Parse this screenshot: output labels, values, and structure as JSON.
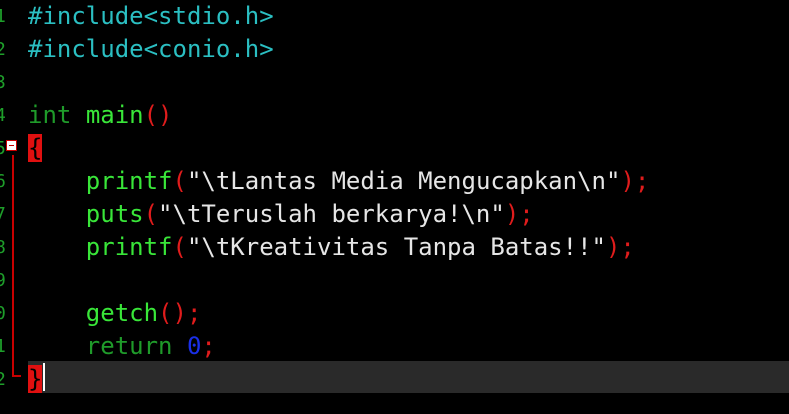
{
  "editor": {
    "gutter_numbers": [
      "1",
      "2",
      "3",
      "4",
      "5",
      "6",
      "7",
      "8",
      "9",
      "0",
      "1",
      "2"
    ],
    "lines": [
      {
        "tokens": [
          {
            "t": "#include<stdio.h>",
            "c": "pp"
          }
        ]
      },
      {
        "tokens": [
          {
            "t": "#include<conio.h>",
            "c": "pp"
          }
        ]
      },
      {
        "tokens": []
      },
      {
        "tokens": [
          {
            "t": "int",
            "c": "kw"
          },
          {
            "t": " ",
            "c": "str"
          },
          {
            "t": "main",
            "c": "fn"
          },
          {
            "t": "()",
            "c": "par"
          }
        ]
      },
      {
        "tokens": [
          {
            "t": "{",
            "c": "brace-hl-dark"
          }
        ]
      },
      {
        "tokens": [
          {
            "t": "    ",
            "c": "str"
          },
          {
            "t": "printf",
            "c": "fn"
          },
          {
            "t": "(",
            "c": "par"
          },
          {
            "t": "\"\\tLantas Media Mengucapkan\\n\"",
            "c": "str"
          },
          {
            "t": ");",
            "c": "par"
          }
        ]
      },
      {
        "tokens": [
          {
            "t": "    ",
            "c": "str"
          },
          {
            "t": "puts",
            "c": "fn"
          },
          {
            "t": "(",
            "c": "par"
          },
          {
            "t": "\"\\tTeruslah berkarya!\\n\"",
            "c": "str"
          },
          {
            "t": ");",
            "c": "par"
          }
        ]
      },
      {
        "tokens": [
          {
            "t": "    ",
            "c": "str"
          },
          {
            "t": "printf",
            "c": "fn"
          },
          {
            "t": "(",
            "c": "par"
          },
          {
            "t": "\"\\tKreativitas Tanpa Batas!!\"",
            "c": "str"
          },
          {
            "t": ");",
            "c": "par"
          }
        ]
      },
      {
        "tokens": []
      },
      {
        "tokens": [
          {
            "t": "    ",
            "c": "str"
          },
          {
            "t": "getch",
            "c": "fn"
          },
          {
            "t": "();",
            "c": "par"
          }
        ]
      },
      {
        "tokens": [
          {
            "t": "    ",
            "c": "str"
          },
          {
            "t": "return",
            "c": "kw"
          },
          {
            "t": " ",
            "c": "str"
          },
          {
            "t": "0",
            "c": "num"
          },
          {
            "t": ";",
            "c": "par"
          }
        ]
      },
      {
        "tokens": [
          {
            "t": "}",
            "c": "brace-hl-dark"
          }
        ]
      }
    ]
  }
}
